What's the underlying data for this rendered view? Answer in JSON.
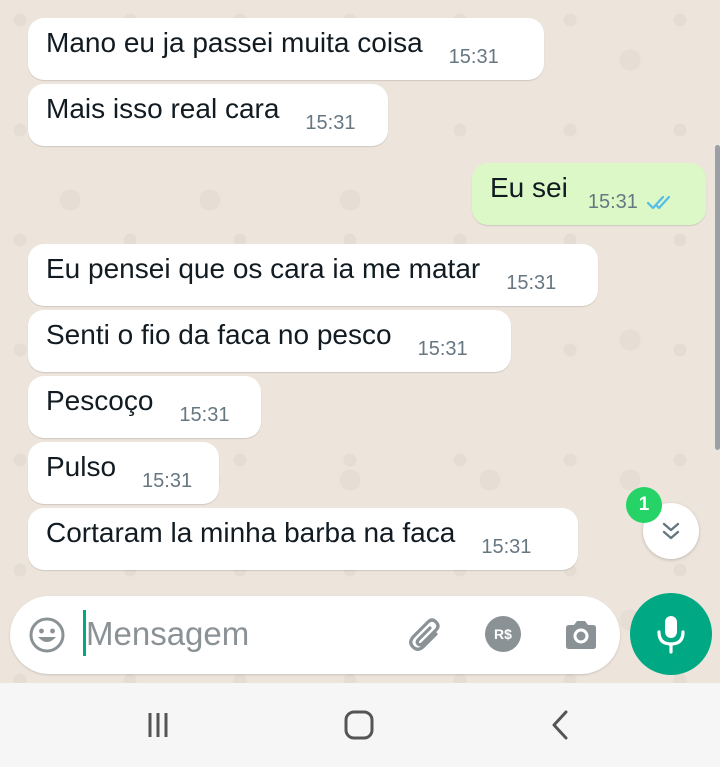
{
  "messages": [
    {
      "direction": "in",
      "text": "Mano eu ja passei muita coisa",
      "time": "15:31"
    },
    {
      "direction": "in",
      "text": "Mais isso real cara",
      "time": "15:31"
    },
    {
      "direction": "out",
      "text": "Eu sei",
      "time": "15:31",
      "status": "read"
    },
    {
      "direction": "in",
      "text": "Eu pensei que os cara ia me matar",
      "time": "15:31"
    },
    {
      "direction": "in",
      "text": "Senti o fio da faca no pesco",
      "time": "15:31"
    },
    {
      "direction": "in",
      "text": "Pescoço",
      "time": "15:31"
    },
    {
      "direction": "in",
      "text": "Pulso",
      "time": "15:31"
    },
    {
      "direction": "in",
      "text": "Cortaram la minha barba na faca",
      "time": "15:31"
    }
  ],
  "scroll_down": {
    "unread_count": "1",
    "icon": "double-chevron-down-icon"
  },
  "composer": {
    "placeholder": "Mensagem",
    "value": "",
    "emoji_icon": "emoji-icon",
    "attach_icon": "paperclip-icon",
    "payment_label": "R$",
    "camera_icon": "camera-icon",
    "mic_icon": "microphone-icon"
  },
  "navbar": {
    "icons": [
      "recent-apps-icon",
      "home-icon",
      "back-icon"
    ]
  },
  "colors": {
    "incoming_bubble": "#ffffff",
    "outgoing_bubble": "#dcf8c6",
    "accent": "#00a884",
    "badge": "#25d366",
    "read_ticks": "#53bdeb"
  }
}
